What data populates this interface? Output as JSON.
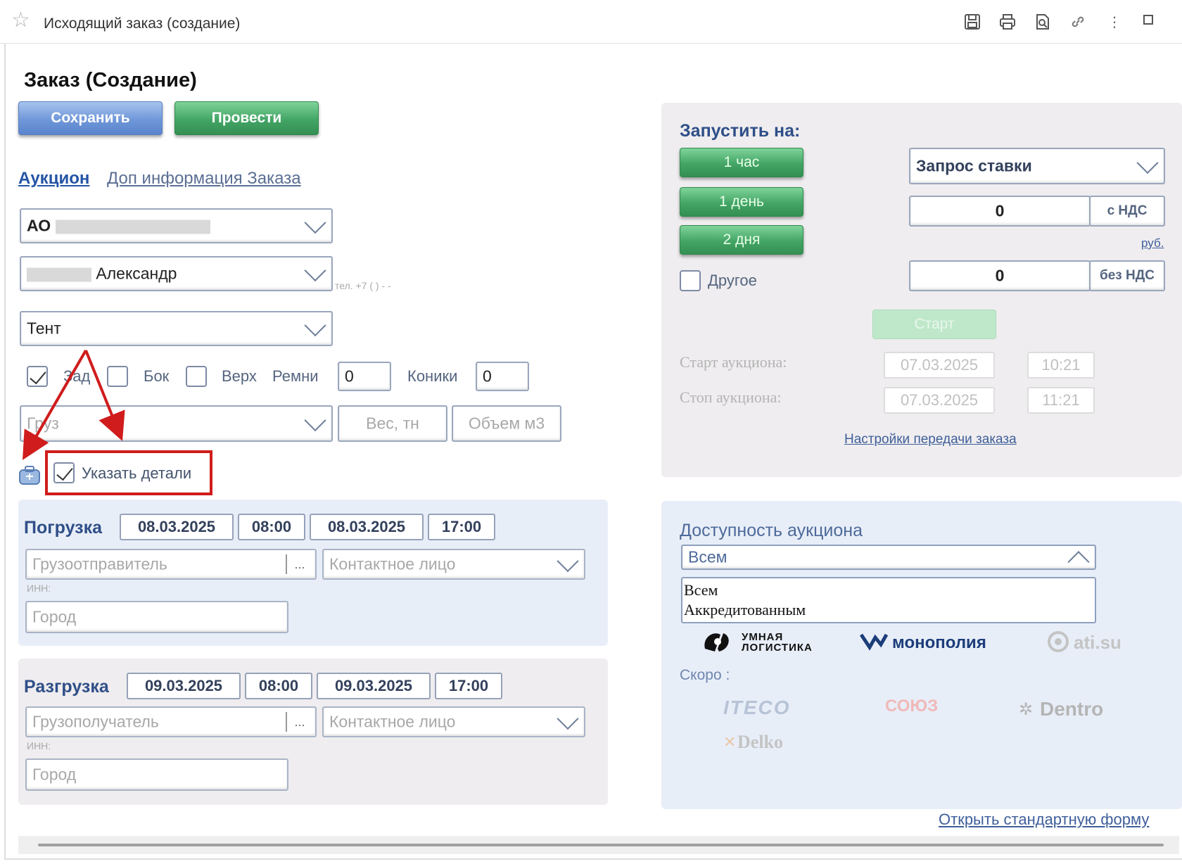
{
  "window": {
    "title": "Исходящий заказ (создание)"
  },
  "header": {
    "title": "Заказ (Создание)",
    "save_label": "Сохранить",
    "post_label": "Провести"
  },
  "tabs": [
    {
      "label": "Аукцион"
    },
    {
      "label": "Доп информация Заказа"
    }
  ],
  "form": {
    "company_prefix": "АО",
    "contact_name": "Александр",
    "phone_hint": "тел. +7 ( ) - -",
    "body_type": "Тент",
    "loading_options": [
      {
        "label": "Зад",
        "checked": true
      },
      {
        "label": "Бок",
        "checked": false
      },
      {
        "label": "Верх",
        "checked": false
      }
    ],
    "straps_label": "Ремни",
    "straps_value": "0",
    "cones_label": "Коники",
    "cones_value": "0",
    "cargo_placeholder": "Груз",
    "weight_placeholder": "Вес, тн",
    "volume_placeholder": "Объем м3",
    "details_label": "Указать детали",
    "details_checked": true
  },
  "loading": {
    "title": "Погрузка",
    "date_from": "08.03.2025",
    "time_from": "08:00",
    "date_to": "08.03.2025",
    "time_to": "17:00",
    "party_placeholder": "Грузоотправитель",
    "more_btn": "...",
    "contact_placeholder": "Контактное лицо",
    "inn_label": "ИНН:",
    "city_placeholder": "Город"
  },
  "unloading": {
    "title": "Разгрузка",
    "date_from": "09.03.2025",
    "time_from": "08:00",
    "date_to": "09.03.2025",
    "time_to": "17:00",
    "party_placeholder": "Грузополучатель",
    "more_btn": "...",
    "contact_placeholder": "Контактное лицо",
    "inn_label": "ИНН:",
    "city_placeholder": "Город"
  },
  "launch": {
    "title": "Запустить на:",
    "durations": [
      "1 час",
      "1 день",
      "2 дня"
    ],
    "other_label": "Другое",
    "mode_value": "Запрос ставки",
    "price_with_vat": "0",
    "with_vat_label": "с НДС",
    "currency_label": "руб.",
    "price_without_vat": "0",
    "without_vat_label": "без НДС",
    "start_label": "Старт",
    "start_auction_label": "Старт аукциона:",
    "start_date": "07.03.2025",
    "start_time": "10:21",
    "stop_auction_label": "Стоп аукциона:",
    "stop_date": "07.03.2025",
    "stop_time": "11:21",
    "settings_link": "Настройки передачи заказа"
  },
  "availability": {
    "title": "Доступность аукциона",
    "selected": "Всем",
    "options": [
      "Всем",
      "Аккредитованным"
    ],
    "partners": [
      "УМНАЯ ЛОГИСТИКА",
      "монополия",
      "ati.su"
    ],
    "soon_label": "Скоро :",
    "soon_partners": [
      "ITECO",
      "СОЮЗ",
      "Dentro",
      "Delko"
    ]
  },
  "footer": {
    "open_standard_link": "Открыть стандартную форму"
  },
  "colors": {
    "accent_blue": "#2454a5",
    "button_green": "#43a565",
    "button_blue": "#6f97d9",
    "highlight_red": "#d01c1c"
  }
}
